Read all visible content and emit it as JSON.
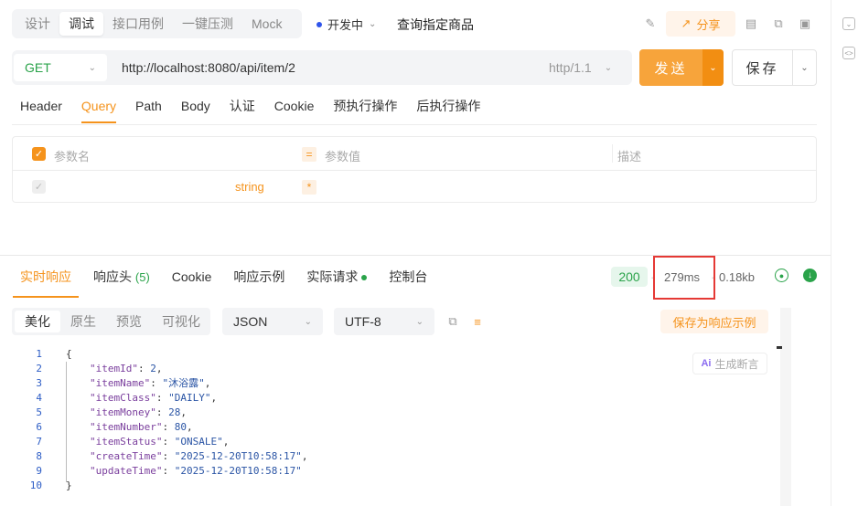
{
  "top_tabs": [
    {
      "label": "设计"
    },
    {
      "label": "调试",
      "active": true
    },
    {
      "label": "接口用例"
    },
    {
      "label": "一键压测"
    },
    {
      "label": "Mock"
    }
  ],
  "environment": "开发中",
  "api_name": "查询指定商品",
  "share_label": "分享",
  "request": {
    "method": "GET",
    "url": "http://localhost:8080/api/item/2",
    "protocol": "http/1.1",
    "send_label": "发送",
    "save_label": "保存"
  },
  "request_tabs": [
    "Header",
    "Query",
    "Path",
    "Body",
    "认证",
    "Cookie",
    "预执行操作",
    "后执行操作"
  ],
  "active_request_tab": "Query",
  "params_table": {
    "headers": [
      "参数名",
      "参数值",
      "描述"
    ],
    "row": {
      "type": "string"
    }
  },
  "response_tabs": [
    {
      "label": "实时响应"
    },
    {
      "label": "响应头",
      "count": "(5)"
    },
    {
      "label": "Cookie"
    },
    {
      "label": "响应示例"
    },
    {
      "label": "实际请求",
      "dot": true
    },
    {
      "label": "控制台"
    }
  ],
  "response_meta": {
    "status": "200",
    "time": "279ms",
    "size": "0.18kb",
    "separator": "·"
  },
  "view_tabs": [
    "美化",
    "原生",
    "预览",
    "可视化"
  ],
  "format_select": "JSON",
  "encoding_select": "UTF-8",
  "save_example_label": "保存为响应示例",
  "ai_button_label": "生成断言",
  "ai_badge": "Ai",
  "code_lines": [
    {
      "n": "1",
      "text": "{"
    },
    {
      "n": "2",
      "key": "\"itemId\"",
      "val": "2",
      "kind": "num",
      "comma": ","
    },
    {
      "n": "3",
      "key": "\"itemName\"",
      "val": "\"沐浴露\"",
      "kind": "str",
      "comma": ","
    },
    {
      "n": "4",
      "key": "\"itemClass\"",
      "val": "\"DAILY\"",
      "kind": "str",
      "comma": ","
    },
    {
      "n": "5",
      "key": "\"itemMoney\"",
      "val": "28",
      "kind": "num",
      "comma": ","
    },
    {
      "n": "6",
      "key": "\"itemNumber\"",
      "val": "80",
      "kind": "num",
      "comma": ","
    },
    {
      "n": "7",
      "key": "\"itemStatus\"",
      "val": "\"ONSALE\"",
      "kind": "str",
      "comma": ","
    },
    {
      "n": "8",
      "key": "\"createTime\"",
      "val": "\"2025-12-20T10:58:17\"",
      "kind": "str",
      "comma": ","
    },
    {
      "n": "9",
      "key": "\"updateTime\"",
      "val": "\"2025-12-20T10:58:17\"",
      "kind": "str",
      "comma": ""
    },
    {
      "n": "10",
      "text": "}"
    }
  ],
  "colors": {
    "accent": "#f5931c",
    "success": "#2aa34a",
    "highlight_box": "#e53935"
  }
}
